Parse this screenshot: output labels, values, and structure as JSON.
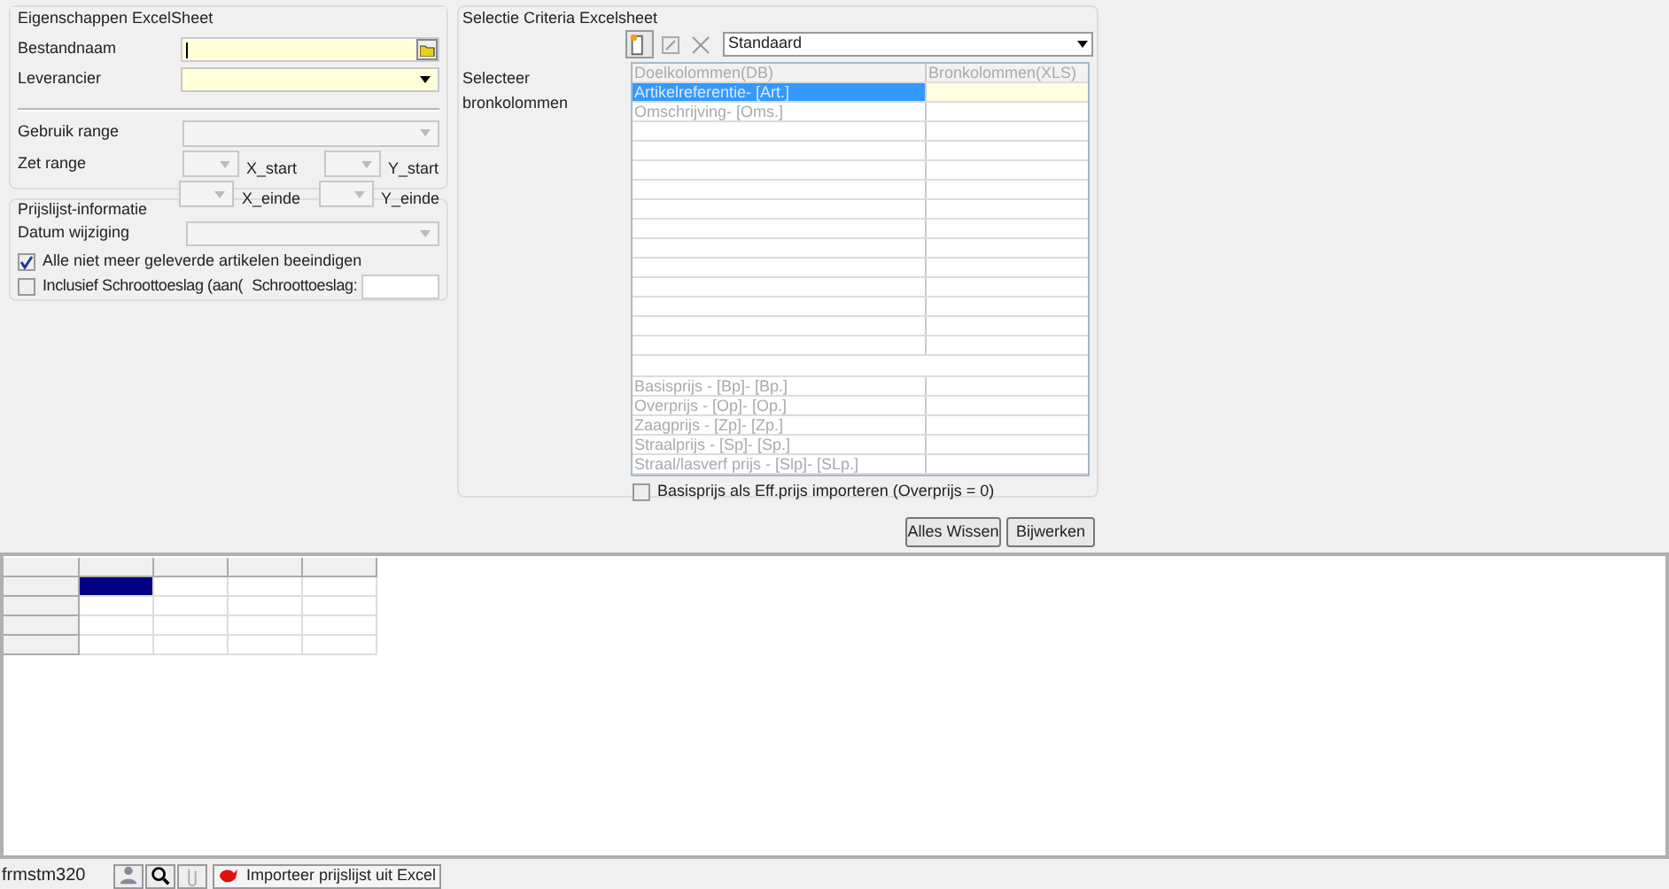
{
  "excel_properties": {
    "title": "Eigenschappen ExcelSheet",
    "file_label": "Bestandnaam",
    "supplier_label": "Leverancier",
    "use_range_label": "Gebruik range",
    "set_range_label": "Zet range",
    "x_start_label": "X_start",
    "y_start_label": "Y_start",
    "x_end_label": "X_einde",
    "y_end_label": "Y_einde"
  },
  "pricelist_info": {
    "title": "Prijslijst-informatie",
    "date_label": "Datum wijziging",
    "end_articles": {
      "label": "Alle niet meer geleverde artikelen beeindigen",
      "checked": true
    },
    "scrap_surcharge": {
      "label": "Inclusief Schroottoeslag (aan(",
      "checked": false
    },
    "scrap_label": "Schroottoeslag:"
  },
  "selection_criteria": {
    "title": "Selectie Criteria Excelsheet",
    "profile": "Standaard",
    "columns_label": "Selecteer bronkolommen",
    "headers": [
      "Doelkolommen(DB)",
      "Bronkolommen(XLS)"
    ],
    "top_rows": [
      {
        "target": "Artikelreferentie- [Art.]",
        "selected": true
      },
      {
        "target": "Omschrijving- [Oms.]",
        "selected": false
      }
    ],
    "price_rows": [
      {
        "target": "Basisprijs - [Bp]- [Bp.]"
      },
      {
        "target": "Overprijs - [Op]- [Op.]"
      },
      {
        "target": "Zaagprijs - [Zp]- [Zp.]"
      },
      {
        "target": "Straalprijs - [Sp]- [Sp.]"
      },
      {
        "target": "Straal/lasverf prijs - [Slp]- [SLp.]"
      }
    ],
    "base_as_eff": {
      "label": "Basisprijs als Eff.prijs importeren (Overprijs = 0)",
      "checked": false
    }
  },
  "buttons": [
    "Alles Wissen",
    "Bijwerken"
  ],
  "sheet_grid": {
    "rows": [
      [
        {
          "selected": true
        },
        {
          "selected": false
        },
        {
          "selected": false
        },
        {
          "selected": false
        }
      ],
      [
        {
          "selected": false
        },
        {
          "selected": false
        },
        {
          "selected": false
        },
        {
          "selected": false
        }
      ],
      [
        {
          "selected": false
        },
        {
          "selected": false
        },
        {
          "selected": false
        },
        {
          "selected": false
        }
      ],
      [
        {
          "selected": false
        },
        {
          "selected": false
        },
        {
          "selected": false
        },
        {
          "selected": false
        }
      ]
    ]
  },
  "status_bar": {
    "form_name": "frmstm320",
    "task": "Importeer prijslijst uit Excel"
  }
}
